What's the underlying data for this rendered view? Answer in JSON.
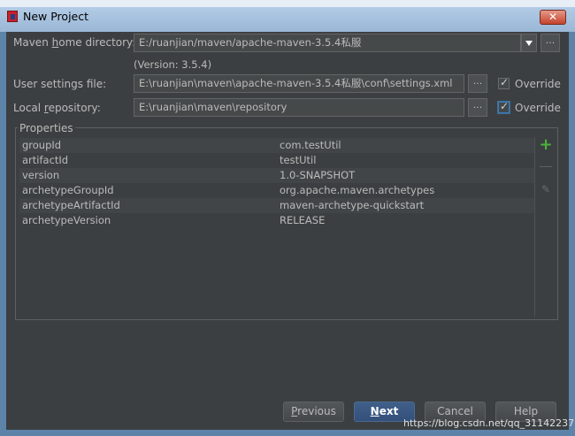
{
  "window": {
    "title": "New Project",
    "close_symbol": "✕"
  },
  "maven_home": {
    "label_pre": "Maven ",
    "label_mnemonic": "h",
    "label_post": "ome directory:",
    "value": "E:/ruanjian/maven/apache-maven-3.5.4私服",
    "version": "(Version: 3.5.4)",
    "browse_label": "..."
  },
  "user_settings": {
    "label": "User settings file:",
    "value": "E:\\ruanjian\\maven\\apache-maven-3.5.4私服\\conf\\settings.xml",
    "browse_label": "...",
    "override_label": "Override",
    "override_checked": true
  },
  "local_repo": {
    "label_pre": "Local ",
    "label_mnemonic": "r",
    "label_post": "epository:",
    "value": "E:\\ruanjian\\maven\\repository",
    "browse_label": "...",
    "override_label": "Override",
    "override_checked": true
  },
  "properties": {
    "title": "Properties",
    "rows": [
      {
        "key": "groupId",
        "value": "com.testUtil"
      },
      {
        "key": "artifactId",
        "value": "testUtil"
      },
      {
        "key": "version",
        "value": "1.0-SNAPSHOT"
      },
      {
        "key": "archetypeGroupId",
        "value": "org.apache.maven.archetypes"
      },
      {
        "key": "archetypeArtifactId",
        "value": "maven-archetype-quickstart"
      },
      {
        "key": "archetypeVersion",
        "value": "RELEASE"
      }
    ],
    "toolbar": {
      "add_icon": "add-icon",
      "remove_icon": "remove-icon",
      "edit_icon": "edit-icon"
    }
  },
  "buttons": {
    "previous_mnemonic": "P",
    "previous_rest": "revious",
    "next_mnemonic": "N",
    "next_rest": "ext",
    "cancel": "Cancel",
    "help": "Help"
  },
  "watermark": "https://blog.csdn.net/qq_31142237",
  "colors": {
    "accent": "#4a88c7",
    "add_green": "#4ab43c",
    "primary_button": "#34507a"
  }
}
